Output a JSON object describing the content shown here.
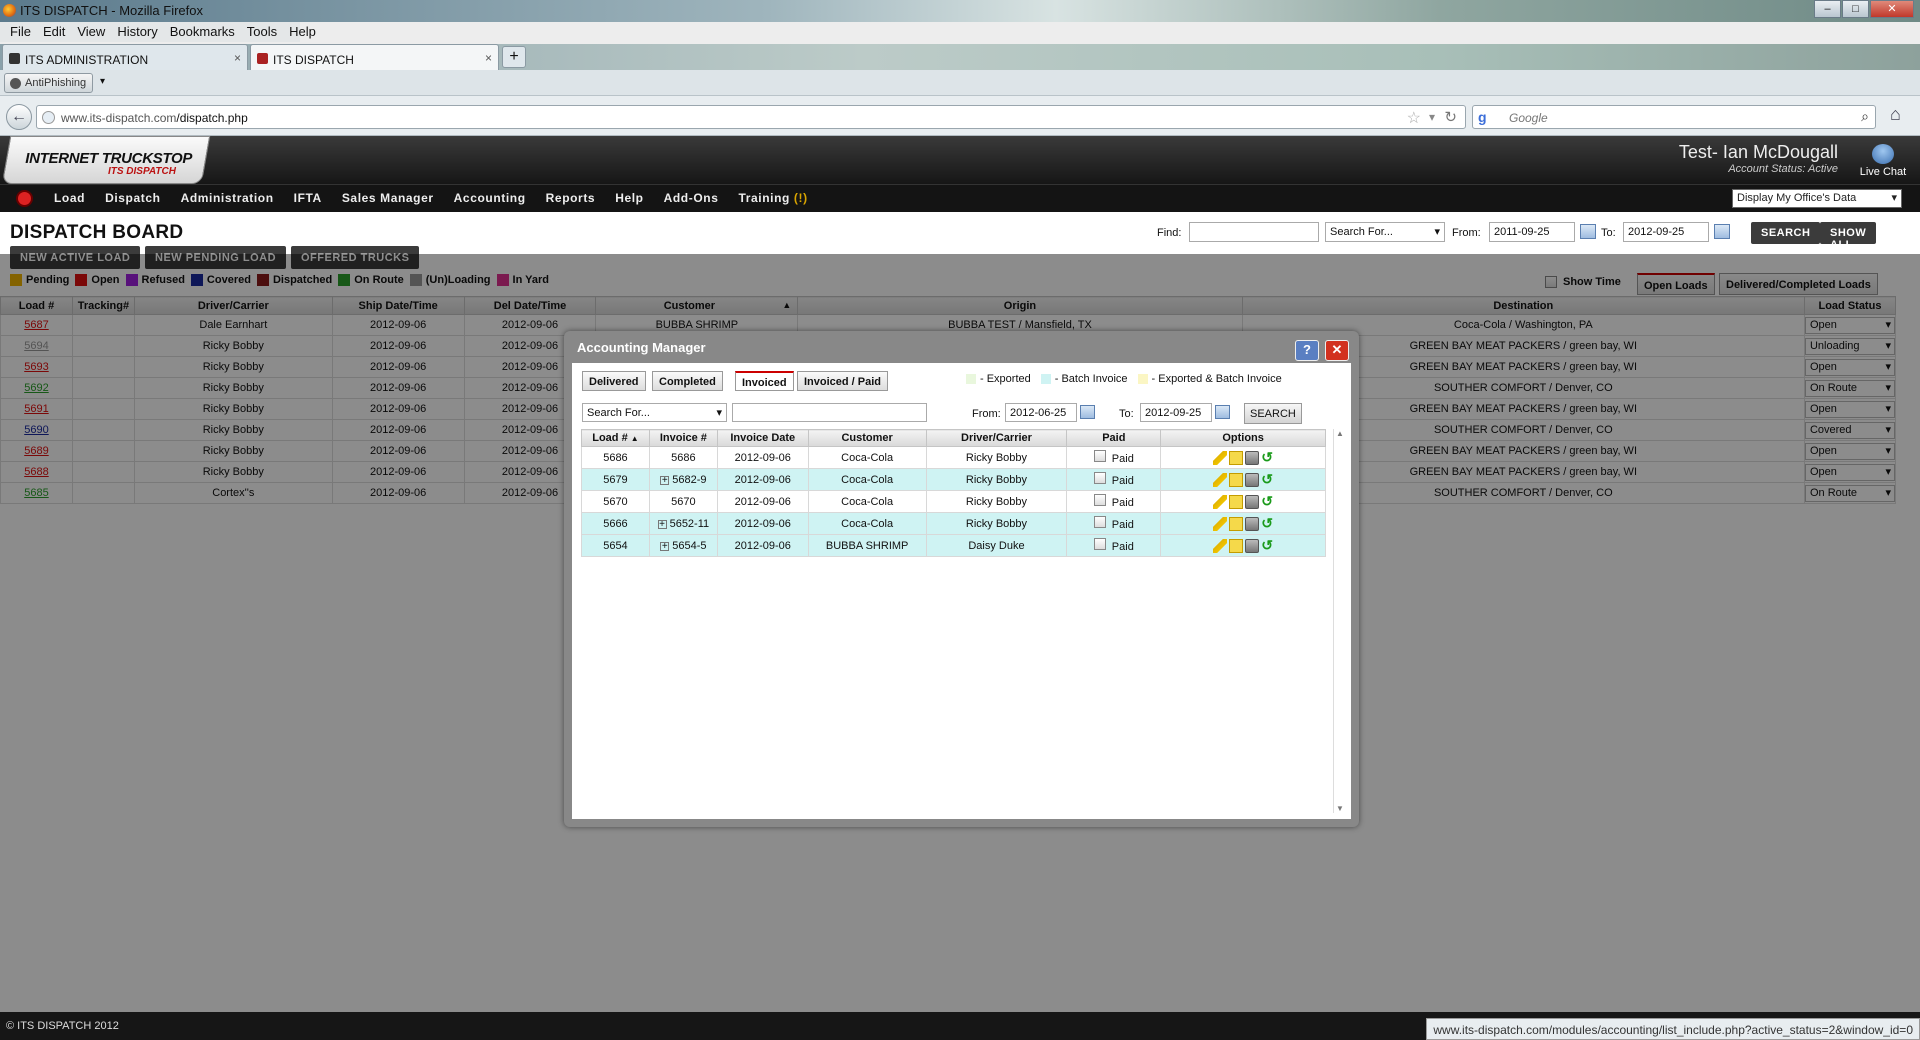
{
  "window": {
    "title": "ITS DISPATCH - Mozilla Firefox"
  },
  "menu": [
    "File",
    "Edit",
    "View",
    "History",
    "Bookmarks",
    "Tools",
    "Help"
  ],
  "tabs": [
    {
      "label": "ITS ADMINISTRATION"
    },
    {
      "label": "ITS DISPATCH"
    }
  ],
  "addon": {
    "antiphishing": "AntiPhishing"
  },
  "nav": {
    "url_prefix": "www.its-dispatch.com",
    "url_path": "/dispatch.php",
    "search_placeholder": "Google"
  },
  "header": {
    "logo_main": "INTERNET TRUCKSTOP",
    "logo_sub": "ITS DISPATCH",
    "user_name": "Test- Ian McDougall",
    "account_status": "Account Status: Active",
    "live_chat": "Live Chat"
  },
  "mainnav": {
    "items": [
      "Load",
      "Dispatch",
      "Administration",
      "IFTA",
      "Sales Manager",
      "Accounting",
      "Reports",
      "Help",
      "Add-Ons",
      "Training"
    ],
    "training_badge": "(!)",
    "office_select": "Display My Office's Data"
  },
  "page": {
    "title": "DISPATCH BOARD",
    "buttons": {
      "new_active": "NEW ACTIVE LOAD",
      "new_pending": "NEW PENDING LOAD",
      "offered": "OFFERED TRUCKS"
    },
    "find_label": "Find:",
    "search_for": "Search For...",
    "from_label": "From:",
    "from_date": "2011-09-25",
    "to_label": "To:",
    "to_date": "2012-09-25",
    "search_btn": "SEARCH",
    "show_all_btn": "SHOW ALL",
    "show_time": "Show Time",
    "open_loads": "Open Loads",
    "delivered_loads": "Delivered/Completed Loads"
  },
  "legend": [
    {
      "label": "Pending",
      "color": "#f0b400"
    },
    {
      "label": "Open",
      "color": "#e01010"
    },
    {
      "label": "Refused",
      "color": "#a020e0"
    },
    {
      "label": "Covered",
      "color": "#1a2aa0"
    },
    {
      "label": "Dispatched",
      "color": "#8b1a1a"
    },
    {
      "label": "On Route",
      "color": "#2aa02a"
    },
    {
      "label": "(Un)Loading",
      "color": "#999999"
    },
    {
      "label": "In Yard",
      "color": "#e03090"
    }
  ],
  "dispatch_table": {
    "columns": [
      "Load #",
      "Tracking#",
      "Driver/Carrier",
      "Ship Date/Time",
      "Del Date/Time",
      "Customer",
      "Origin",
      "Destination",
      "Load Status"
    ],
    "rows": [
      {
        "load": "5687",
        "color": "#e01010",
        "tracking": "",
        "driver": "Dale Earnhart",
        "ship": "2012-09-06",
        "del": "2012-09-06",
        "customer": "BUBBA SHRIMP",
        "origin": "BUBBA TEST / Mansfield, TX",
        "dest": "Coca-Cola / Washington, PA",
        "status": "Open"
      },
      {
        "load": "5694",
        "color": "#999999",
        "tracking": "",
        "driver": "Ricky Bobby",
        "ship": "2012-09-06",
        "del": "2012-09-06",
        "customer": "",
        "origin": "",
        "dest": "GREEN BAY MEAT PACKERS / green bay, WI",
        "status": "Unloading"
      },
      {
        "load": "5693",
        "color": "#e01010",
        "tracking": "",
        "driver": "Ricky Bobby",
        "ship": "2012-09-06",
        "del": "2012-09-06",
        "customer": "",
        "origin": "",
        "dest": "GREEN BAY MEAT PACKERS / green bay, WI",
        "status": "Open"
      },
      {
        "load": "5692",
        "color": "#2aa02a",
        "tracking": "",
        "driver": "Ricky Bobby",
        "ship": "2012-09-06",
        "del": "2012-09-06",
        "customer": "",
        "origin": "",
        "dest": "SOUTHER COMFORT / Denver, CO",
        "status": "On Route"
      },
      {
        "load": "5691",
        "color": "#e01010",
        "tracking": "",
        "driver": "Ricky Bobby",
        "ship": "2012-09-06",
        "del": "2012-09-06",
        "customer": "",
        "origin": "",
        "dest": "GREEN BAY MEAT PACKERS / green bay, WI",
        "status": "Open"
      },
      {
        "load": "5690",
        "color": "#1a2aa0",
        "tracking": "",
        "driver": "Ricky Bobby",
        "ship": "2012-09-06",
        "del": "2012-09-06",
        "customer": "",
        "origin": "",
        "dest": "SOUTHER COMFORT / Denver, CO",
        "status": "Covered"
      },
      {
        "load": "5689",
        "color": "#e01010",
        "tracking": "",
        "driver": "Ricky Bobby",
        "ship": "2012-09-06",
        "del": "2012-09-06",
        "customer": "",
        "origin": "",
        "dest": "GREEN BAY MEAT PACKERS / green bay, WI",
        "status": "Open"
      },
      {
        "load": "5688",
        "color": "#e01010",
        "tracking": "",
        "driver": "Ricky Bobby",
        "ship": "2012-09-06",
        "del": "2012-09-06",
        "customer": "",
        "origin": "",
        "dest": "GREEN BAY MEAT PACKERS / green bay, WI",
        "status": "Open"
      },
      {
        "load": "5685",
        "color": "#2aa02a",
        "tracking": "",
        "driver": "Cortex''s",
        "ship": "2012-09-06",
        "del": "2012-09-06",
        "customer": "",
        "origin": "",
        "dest": "SOUTHER COMFORT / Denver, CO",
        "status": "On Route"
      }
    ]
  },
  "modal": {
    "title": "Accounting Manager",
    "tabs": [
      "Delivered",
      "Completed",
      "Invoiced",
      "Invoiced / Paid"
    ],
    "active_tab": "Invoiced",
    "legend": [
      {
        "label": "- Exported",
        "color": "#e9f7dd"
      },
      {
        "label": "- Batch Invoice",
        "color": "#cff3f3"
      },
      {
        "label": "- Exported & Batch Invoice",
        "color": "#fbf6c4"
      }
    ],
    "search_for": "Search For...",
    "from_label": "From:",
    "from_date": "2012-06-25",
    "to_label": "To:",
    "to_date": "2012-09-25",
    "search_btn": "SEARCH",
    "columns": [
      "Load #",
      "Invoice #",
      "Invoice Date",
      "Customer",
      "Driver/Carrier",
      "Paid",
      "Options"
    ],
    "paid_label": "Paid",
    "rows": [
      {
        "load": "5686",
        "invoice": "5686",
        "batch": false,
        "date": "2012-09-06",
        "customer": "Coca-Cola",
        "driver": "Ricky Bobby"
      },
      {
        "load": "5679",
        "invoice": "5682-9",
        "batch": true,
        "date": "2012-09-06",
        "customer": "Coca-Cola",
        "driver": "Ricky Bobby"
      },
      {
        "load": "5670",
        "invoice": "5670",
        "batch": false,
        "date": "2012-09-06",
        "customer": "Coca-Cola",
        "driver": "Ricky Bobby"
      },
      {
        "load": "5666",
        "invoice": "5652-11",
        "batch": true,
        "date": "2012-09-06",
        "customer": "Coca-Cola",
        "driver": "Ricky Bobby"
      },
      {
        "load": "5654",
        "invoice": "5654-5",
        "batch": true,
        "date": "2012-09-06",
        "customer": "BUBBA SHRIMP",
        "driver": "Daisy Duke"
      }
    ]
  },
  "statusbar": {
    "copyright": "© ITS DISPATCH 2012",
    "url": "www.its-dispatch.com/modules/accounting/list_include.php?active_status=2&window_id=0"
  }
}
